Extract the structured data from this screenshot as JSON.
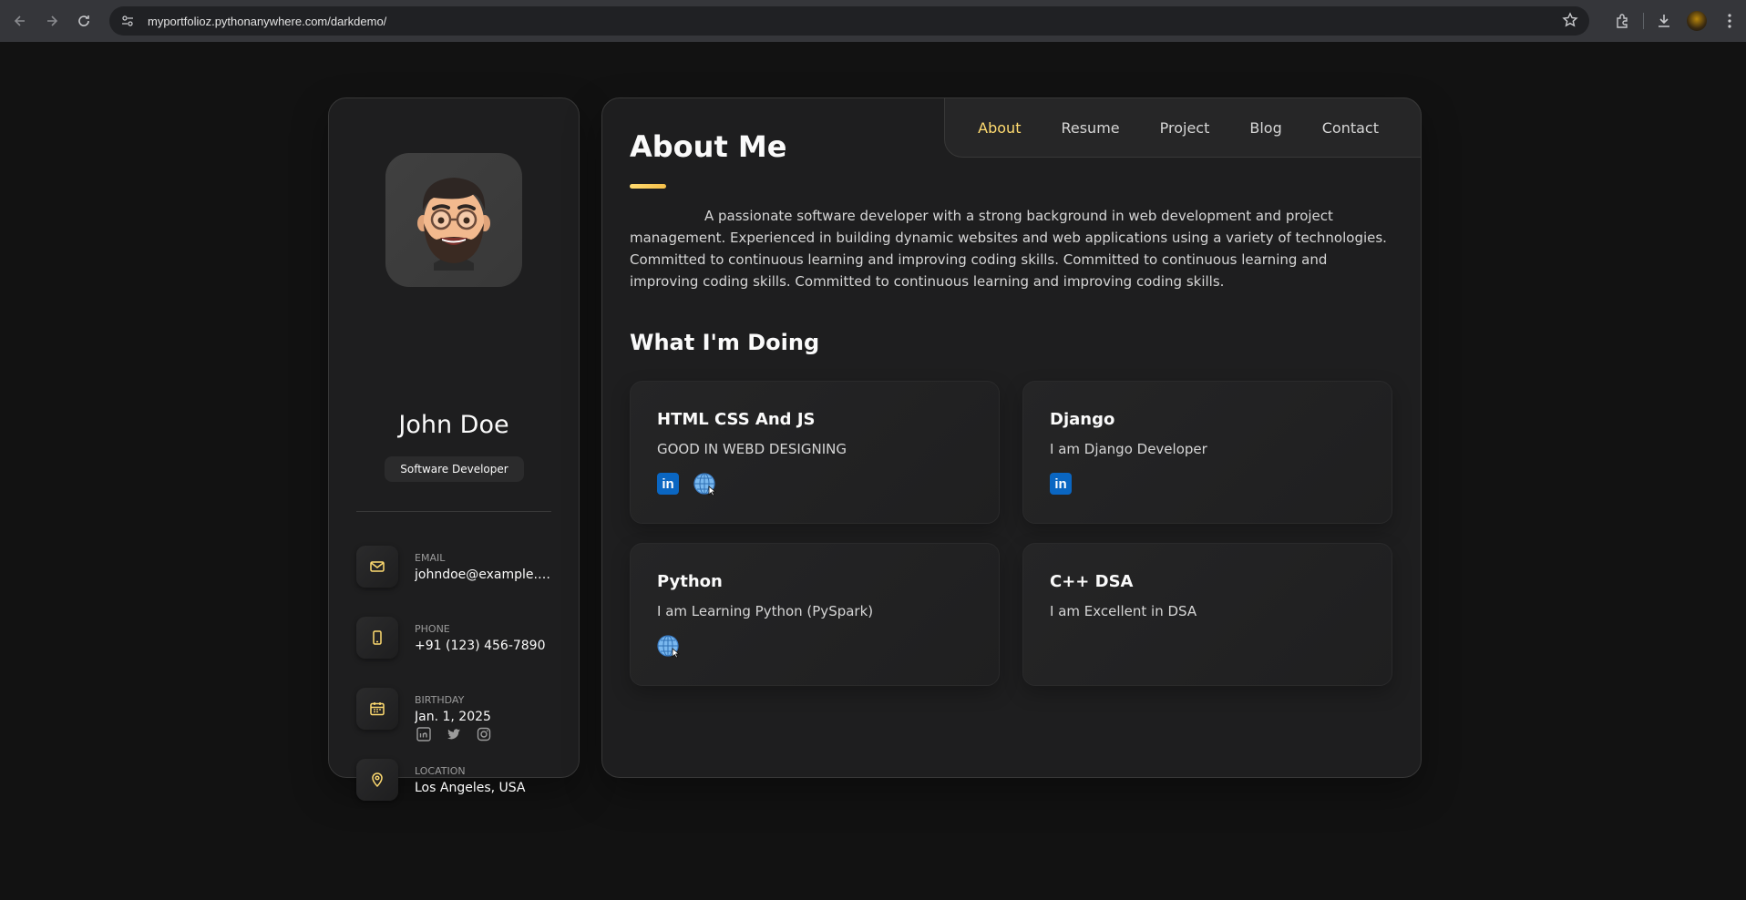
{
  "browser": {
    "url": "myportfolioz.pythonanywhere.com/darkdemo/"
  },
  "sidebar": {
    "name": "John Doe",
    "title": "Software Developer",
    "contacts": [
      {
        "title": "EMAIL",
        "value": "johndoe@example.com",
        "icon": "mail-icon"
      },
      {
        "title": "PHONE",
        "value": "+91 (123) 456-7890",
        "icon": "phone-icon"
      },
      {
        "title": "BIRTHDAY",
        "value": "Jan. 1, 2025",
        "icon": "calendar-icon"
      },
      {
        "title": "LOCATION",
        "value": "Los Angeles, USA",
        "icon": "location-pin-icon"
      }
    ],
    "socials": [
      "linkedin-icon",
      "twitter-icon",
      "instagram-icon"
    ]
  },
  "nav": {
    "items": [
      "About",
      "Resume",
      "Project",
      "Blog",
      "Contact"
    ],
    "active": "About"
  },
  "about": {
    "title": "About Me",
    "text": "A passionate software developer with a strong background in web development and project management. Experienced in building dynamic websites and web applications using a variety of technologies. Committed to continuous learning and improving coding skills. Committed to continuous learning and improving coding skills. Committed to continuous learning and improving coding skills.",
    "section_title": "What I'm Doing",
    "services": [
      {
        "title": "HTML CSS And JS",
        "desc": "GOOD IN WEBD DESIGNING",
        "icons": [
          "linkedin-icon",
          "globe-icon"
        ]
      },
      {
        "title": "Django",
        "desc": "I am Django Developer",
        "icons": [
          "linkedin-icon"
        ]
      },
      {
        "title": "Python",
        "desc": "I am Learning Python (PySpark)",
        "icons": [
          "globe-icon"
        ]
      },
      {
        "title": "C++ DSA",
        "desc": "I am Excellent in DSA",
        "icons": []
      }
    ]
  },
  "colors": {
    "accent": "#ffdb70",
    "background": "#121212",
    "card": "#1e1e1f",
    "linkedin": "#0a66c2"
  }
}
